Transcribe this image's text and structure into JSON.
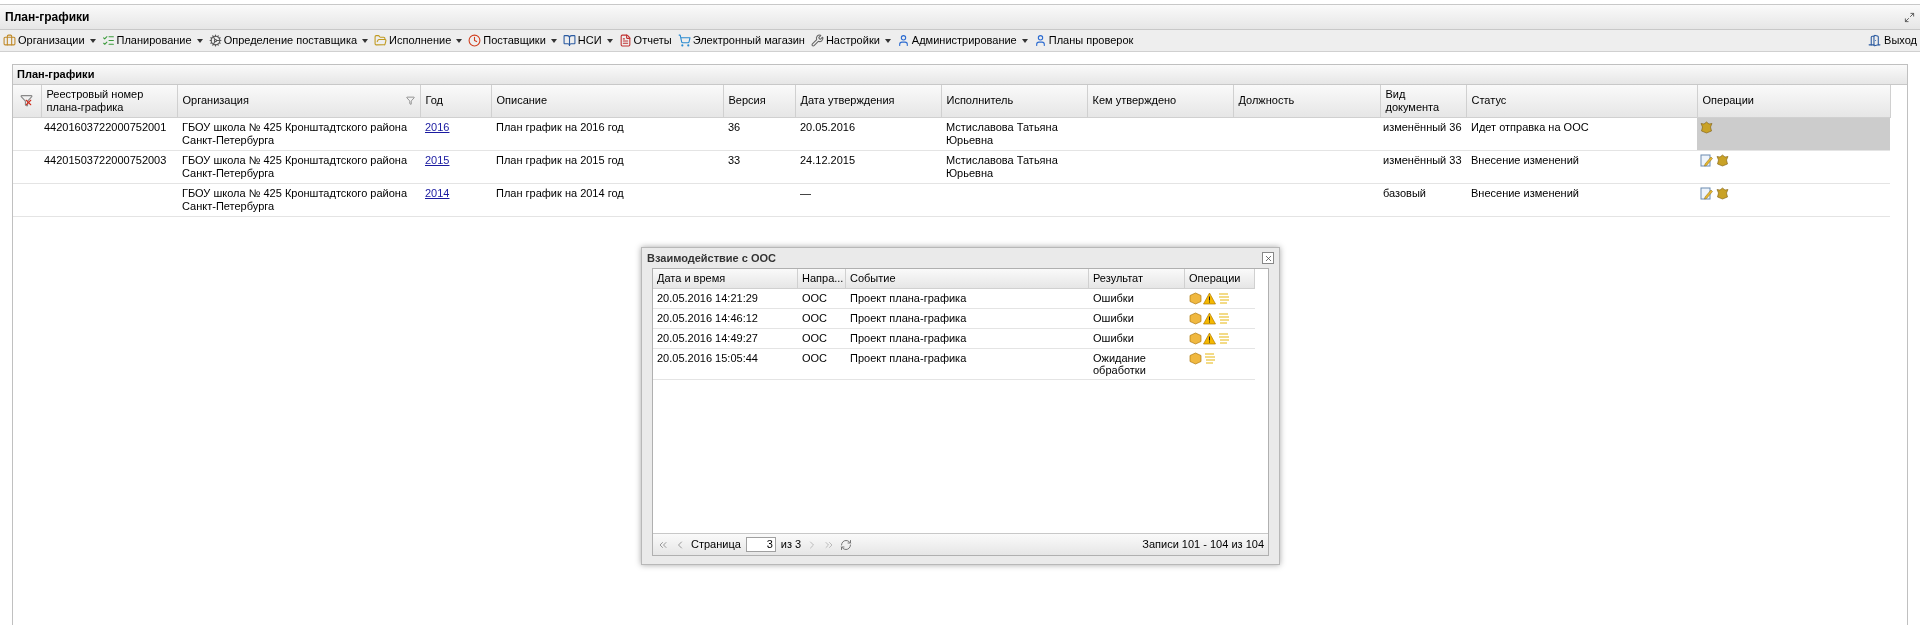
{
  "window": {
    "title": "План-графики"
  },
  "toolbar": {
    "items": [
      {
        "label": "Организации",
        "dropdown": true
      },
      {
        "label": "Планирование",
        "dropdown": true
      },
      {
        "label": "Определение поставщика",
        "dropdown": true
      },
      {
        "label": "Исполнение",
        "dropdown": true
      },
      {
        "label": "Поставщики",
        "dropdown": true
      },
      {
        "label": "НСИ",
        "dropdown": true
      },
      {
        "label": "Отчеты",
        "dropdown": false
      },
      {
        "label": "Электронный магазин",
        "dropdown": false
      },
      {
        "label": "Настройки",
        "dropdown": true
      },
      {
        "label": "Администрирование",
        "dropdown": true
      },
      {
        "label": "Планы проверок",
        "dropdown": false
      }
    ],
    "logout": "Выход"
  },
  "panel": {
    "title": "План-графики",
    "columns": [
      {
        "label": "Реестровый номер плана-графика",
        "filter": false
      },
      {
        "label": "Организация",
        "filter": true
      },
      {
        "label": "Год",
        "filter": false
      },
      {
        "label": "Описание",
        "filter": false
      },
      {
        "label": "Версия",
        "filter": false
      },
      {
        "label": "Дата утверждения",
        "filter": false
      },
      {
        "label": "Исполнитель",
        "filter": false
      },
      {
        "label": "Кем утверждено",
        "filter": false
      },
      {
        "label": "Должность",
        "filter": false
      },
      {
        "label": "Вид документа",
        "filter": false
      },
      {
        "label": "Статус",
        "filter": false
      },
      {
        "label": "Операции",
        "filter": false
      }
    ],
    "rows": [
      {
        "registry_number": "44201603722000752001",
        "organization": "ГБОУ школа № 425 Кронштадтского района Санкт-Петербурга",
        "year": "2016",
        "description": "План график на 2016 год",
        "version": "36",
        "approval_date": "20.05.2016",
        "executor": "Мстиславова Татьяна Юрьевна",
        "document_type": "изменённый 36",
        "status": "Идет отправка на ООС",
        "operations": [
          {
            "kind": "emblem"
          }
        ],
        "selected": true
      },
      {
        "registry_number": "44201503722000752003",
        "organization": "ГБОУ школа № 425 Кронштадтского района Санкт-Петербурга",
        "year": "2015",
        "description": "План график на 2015 год",
        "version": "33",
        "approval_date": "24.12.2015",
        "executor": "Мстиславова Татьяна Юрьевна",
        "document_type": "изменённый 33",
        "status": "Внесение изменений",
        "operations": [
          {
            "kind": "edit"
          },
          {
            "kind": "emblem"
          }
        ],
        "selected": false
      },
      {
        "organization": "ГБОУ школа № 425 Кронштадтского района Санкт-Петербурга",
        "year": "2014",
        "description": "План график на 2014 год",
        "approval_date": "—",
        "document_type": "базовый",
        "status": "Внесение изменений",
        "operations": [
          {
            "kind": "edit"
          },
          {
            "kind": "emblem"
          }
        ],
        "selected": false
      }
    ]
  },
  "dialog": {
    "title": "Взаимодействие с ООС",
    "columns": [
      "Дата и время",
      "Напра...",
      "Событие",
      "Результат",
      "Операции"
    ],
    "rows": [
      {
        "datetime": "20.05.2016 14:21:29",
        "direction": "ООС",
        "event": "Проект плана-графика",
        "result": "Ошибки",
        "operations": [
          {
            "kind": "package"
          },
          {
            "kind": "warning"
          },
          {
            "kind": "document"
          }
        ]
      },
      {
        "datetime": "20.05.2016 14:46:12",
        "direction": "ООС",
        "event": "Проект плана-графика",
        "result": "Ошибки",
        "operations": [
          {
            "kind": "package"
          },
          {
            "kind": "warning"
          },
          {
            "kind": "document"
          }
        ]
      },
      {
        "datetime": "20.05.2016 14:49:27",
        "direction": "ООС",
        "event": "Проект плана-графика",
        "result": "Ошибки",
        "operations": [
          {
            "kind": "package"
          },
          {
            "kind": "warning"
          },
          {
            "kind": "document"
          }
        ]
      },
      {
        "datetime": "20.05.2016 15:05:44",
        "direction": "ООС",
        "event": "Проект плана-графика",
        "result": "Ожидание обработки",
        "operations": [
          {
            "kind": "package"
          },
          {
            "kind": "document"
          }
        ]
      }
    ],
    "pager": {
      "page_label": "Страница",
      "page": "3",
      "of": "из 3",
      "records": "Записи 101 - 104 из 104"
    }
  }
}
